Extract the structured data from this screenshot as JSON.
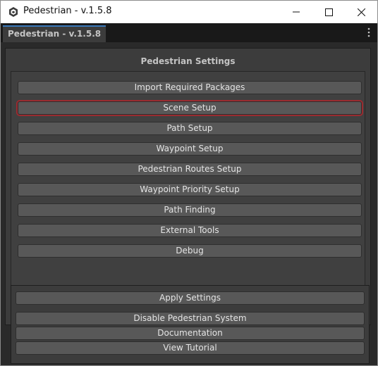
{
  "window": {
    "title": "Pedestrian - v.1.5.8",
    "icons": {
      "app": "unity-cube-icon",
      "minimize": "minimize-icon",
      "maximize": "maximize-icon",
      "close": "close-icon"
    }
  },
  "tabstrip": {
    "tab_label": "Pedestrian - v.1.5.8",
    "menu_icon": "kebab-menu-icon",
    "accent": "#3a79bb"
  },
  "settings": {
    "title": "Pedestrian Settings",
    "buttons": [
      {
        "label": "Import Required Packages"
      },
      {
        "label": "Scene Setup",
        "focused": true
      },
      {
        "label": "Path Setup"
      },
      {
        "label": "Waypoint Setup"
      },
      {
        "label": "Pedestrian Routes Setup"
      },
      {
        "label": "Waypoint Priority Setup"
      },
      {
        "label": "Path Finding"
      },
      {
        "label": "External Tools"
      },
      {
        "label": "Debug"
      }
    ],
    "focus_color": "#9a2b30"
  },
  "footer": {
    "apply": "Apply Settings",
    "disable": "Disable Pedestrian System",
    "documentation": "Documentation",
    "tutorial": "View Tutorial"
  }
}
